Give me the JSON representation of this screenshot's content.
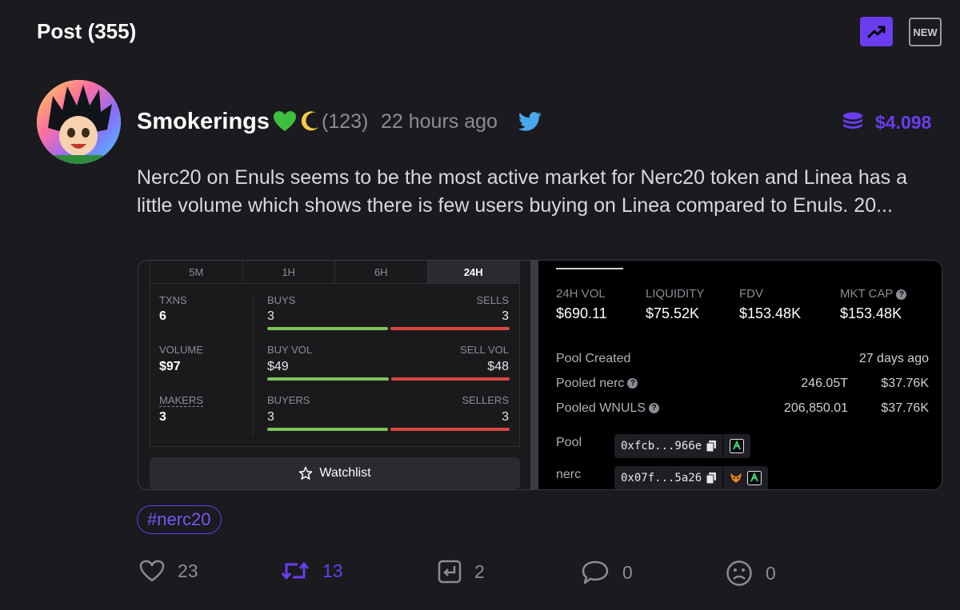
{
  "header": {
    "title": "Post (355)",
    "trending_icon": "trending-up-icon",
    "new_label": "NEW",
    "accent": "#6a3df0"
  },
  "post": {
    "author": "Smokerings",
    "emojis": [
      "green-heart",
      "crescent-moon"
    ],
    "reputation": "(123)",
    "time_ago": "22 hours ago",
    "source_icon": "twitter-icon",
    "tip_icon": "coins-icon",
    "tip_amount": "$4.098",
    "text": "Nerc20 on Enuls seems to be the most active market for Nerc20 token and Linea has a little volume which shows there is few users buying on Linea compared to Enuls. 20...",
    "tag": "#nerc20"
  },
  "embed": {
    "tabs": [
      {
        "label": "5M",
        "active": false
      },
      {
        "label": "1H",
        "active": false
      },
      {
        "label": "6H",
        "active": false
      },
      {
        "label": "24H",
        "active": true
      }
    ],
    "stats": [
      {
        "left_label": "TXNS",
        "left_value": "6",
        "mid_label": "BUYS",
        "mid_value": "3",
        "right_label": "SELLS",
        "right_value": "3",
        "buy_share": 0.5
      },
      {
        "left_label": "VOLUME",
        "left_value": "$97",
        "mid_label": "BUY VOL",
        "mid_value": "$49",
        "right_label": "SELL VOL",
        "right_value": "$48",
        "buy_share": 0.505
      },
      {
        "left_label": "MAKERS",
        "left_value": "3",
        "mid_label": "BUYERS",
        "mid_value": "3",
        "right_label": "SELLERS",
        "right_value": "3",
        "buy_share": 0.5
      }
    ],
    "watchlist_label": "Watchlist",
    "metrics": [
      {
        "label": "24H VOL",
        "value": "$690.11"
      },
      {
        "label": "LIQUIDITY",
        "value": "$75.52K"
      },
      {
        "label": "FDV",
        "value": "$153.48K"
      },
      {
        "label": "MKT CAP",
        "value": "$153.48K"
      }
    ],
    "pool_created_label": "Pool Created",
    "pool_created_value": "27 days ago",
    "pooled": [
      {
        "label": "Pooled nerc",
        "amount": "246.05T",
        "usd": "$37.76K"
      },
      {
        "label": "Pooled WNULS",
        "amount": "206,850.01",
        "usd": "$37.76K"
      }
    ],
    "addresses": [
      {
        "label": "Pool",
        "address": "0xfcb...966e"
      },
      {
        "label": "nerc",
        "address": "0x07f...5a26"
      }
    ]
  },
  "actions": {
    "likes": "23",
    "retweets": "13",
    "replies": "2",
    "comments": "0",
    "dislikes": "0"
  }
}
